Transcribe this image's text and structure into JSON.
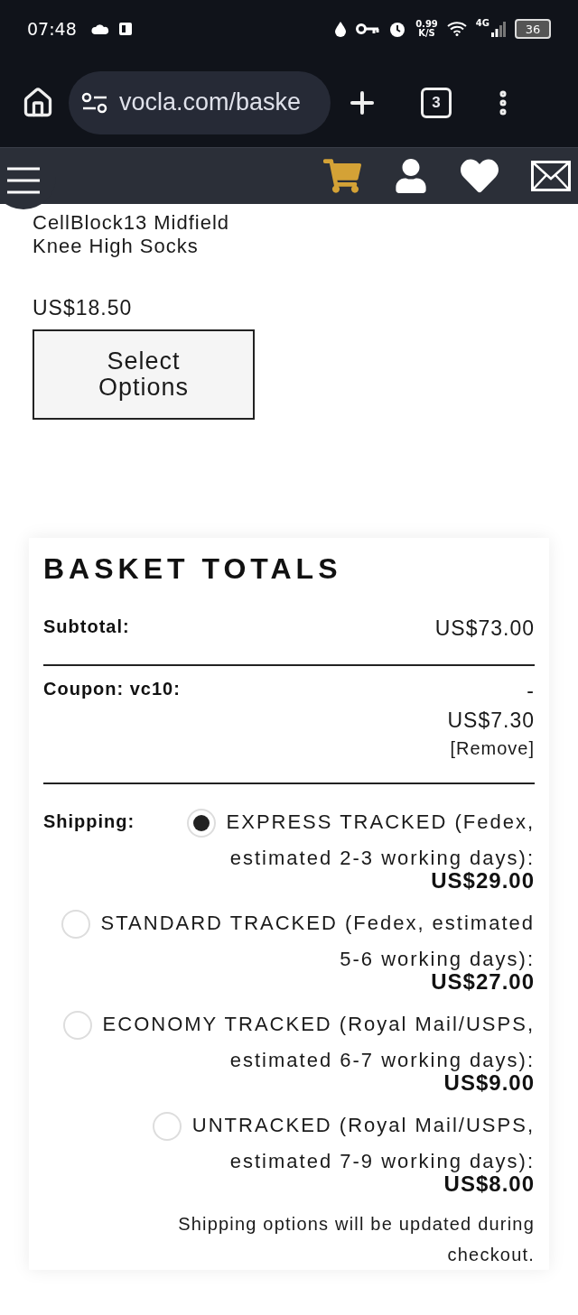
{
  "status_bar": {
    "time": "07:48",
    "net_speed": "0.99",
    "net_unit": "K/S",
    "network": "4G",
    "battery": "36"
  },
  "browser": {
    "url": "vocla.com/baske",
    "tab_count": "3"
  },
  "product": {
    "name": "CellBlock13 Midfield Knee High Socks",
    "price": "US$18.50",
    "button": "Select Options"
  },
  "basket_totals": {
    "title": "BASKET TOTALS",
    "subtotal": {
      "label": "Subtotal:",
      "value": "US$73.00"
    },
    "coupon": {
      "label": "Coupon: vc10:",
      "sign": "-",
      "value": "US$7.30",
      "remove": "[Remove]"
    },
    "shipping": {
      "label": "Shipping:",
      "options": [
        {
          "label": "EXPRESS TRACKED (Fedex, estimated 2-3 working days):",
          "price": "US$29.00",
          "selected": true
        },
        {
          "label": "STANDARD TRACKED (Fedex, estimated 5-6 working days):",
          "price": "US$27.00",
          "selected": false
        },
        {
          "label": "ECONOMY TRACKED (Royal Mail/USPS, estimated 6-7 working days):",
          "price": "US$9.00",
          "selected": false
        },
        {
          "label": "UNTRACKED (Royal Mail/USPS, estimated 7-9 working days):",
          "price": "US$8.00",
          "selected": false
        }
      ]
    },
    "note": "Shipping options will be updated during checkout."
  }
}
